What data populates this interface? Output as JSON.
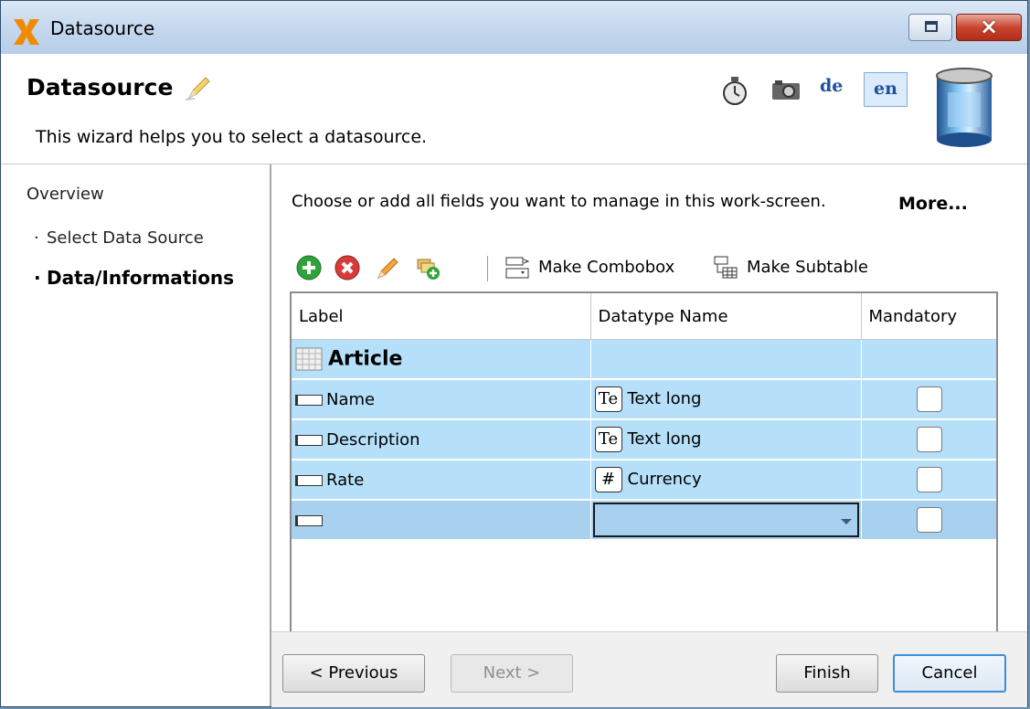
{
  "window": {
    "title": "Datasource",
    "controls": {
      "restore": "restore-icon",
      "close": "×"
    }
  },
  "header": {
    "title": "Datasource",
    "description": "This wizard helps you to select a datasource.",
    "languages": {
      "de": "de",
      "en": "en",
      "selected": "en"
    },
    "icons": [
      "pencil-icon",
      "stopwatch-icon",
      "camera-icon",
      "database-icon"
    ]
  },
  "sidebar": {
    "overview_label": "Overview",
    "steps": [
      {
        "label": "Select Data Source",
        "current": false
      },
      {
        "label": "Data/Informations",
        "current": true
      }
    ]
  },
  "main": {
    "intro": "Choose or add all fields you want to manage in this work-screen.",
    "more_label": "More...",
    "toolbar": {
      "icons": [
        "add-icon",
        "delete-icon",
        "edit-icon",
        "import-icon"
      ],
      "make_combobox": "Make Combobox",
      "make_subtable": "Make Subtable"
    },
    "grid": {
      "columns": [
        "Label",
        "Datatype Name",
        "Mandatory"
      ],
      "group": "Article",
      "rows": [
        {
          "label": "Name",
          "type_icon": "Te",
          "type": "Text long",
          "mandatory": false
        },
        {
          "label": "Description",
          "type_icon": "Te",
          "type": "Text long",
          "mandatory": false
        },
        {
          "label": "Rate",
          "type_icon": "#",
          "type": "Currency",
          "mandatory": false
        }
      ],
      "new_row": {
        "label": "",
        "type": "",
        "mandatory": false
      }
    }
  },
  "footer": {
    "previous": "< Previous",
    "next": "Next >",
    "finish": "Finish",
    "cancel": "Cancel"
  },
  "colors": {
    "row_bg": "#b6e0fa",
    "accent": "#3c8fd6",
    "close_red": "#c9452f"
  }
}
